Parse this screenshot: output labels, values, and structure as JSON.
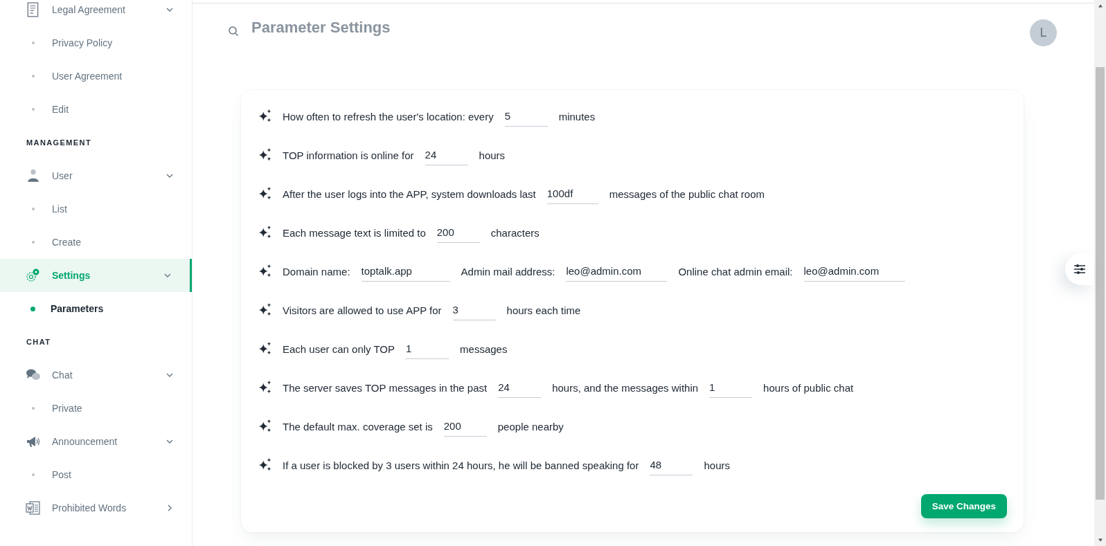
{
  "sidebar": {
    "items": [
      {
        "kind": "group",
        "label": "Legal Agreement",
        "expanded": true,
        "selected": false
      },
      {
        "kind": "sub",
        "label": "Privacy Policy",
        "selected": false
      },
      {
        "kind": "sub",
        "label": "User Agreement",
        "selected": false
      },
      {
        "kind": "sub",
        "label": "Edit",
        "selected": false
      },
      {
        "kind": "section",
        "label": "MANAGEMENT"
      },
      {
        "kind": "group",
        "label": "User",
        "expanded": true,
        "selected": false
      },
      {
        "kind": "sub",
        "label": "List",
        "selected": false
      },
      {
        "kind": "sub",
        "label": "Create",
        "selected": false
      },
      {
        "kind": "group",
        "label": "Settings",
        "expanded": true,
        "selected": true
      },
      {
        "kind": "sub",
        "label": "Parameters",
        "selected": true
      },
      {
        "kind": "section",
        "label": "CHAT"
      },
      {
        "kind": "group",
        "label": "Chat",
        "expanded": true,
        "selected": false
      },
      {
        "kind": "sub",
        "label": "Private",
        "selected": false
      },
      {
        "kind": "group",
        "label": "Announcement",
        "expanded": true,
        "selected": false
      },
      {
        "kind": "sub",
        "label": "Post",
        "selected": false
      },
      {
        "kind": "group",
        "label": "Prohibited Words",
        "expanded": false,
        "selected": false
      }
    ]
  },
  "header": {
    "title": "Parameter Settings",
    "avatar": "L"
  },
  "settings": [
    {
      "parts": [
        {
          "kind": "text",
          "text": "How often to refresh the user's location: every"
        },
        {
          "kind": "field",
          "value": "5"
        },
        {
          "kind": "text",
          "text": "minutes"
        }
      ]
    },
    {
      "parts": [
        {
          "kind": "text",
          "text": "TOP information is online for"
        },
        {
          "kind": "field",
          "value": "24"
        },
        {
          "kind": "text",
          "text": "hours"
        }
      ]
    },
    {
      "parts": [
        {
          "kind": "text",
          "text": "After the user logs into the APP, system downloads last"
        },
        {
          "kind": "field",
          "value": "100df"
        },
        {
          "kind": "text",
          "text": "messages of the public chat room"
        }
      ]
    },
    {
      "parts": [
        {
          "kind": "text",
          "text": "Each message text is limited to"
        },
        {
          "kind": "field",
          "value": "200"
        },
        {
          "kind": "text",
          "text": "characters"
        }
      ]
    },
    {
      "parts": [
        {
          "kind": "text",
          "text": "Domain name:"
        },
        {
          "kind": "field",
          "value": "toptalk.app"
        },
        {
          "kind": "text",
          "text": "Admin mail address:"
        },
        {
          "kind": "field",
          "value": "leo@admin.com"
        },
        {
          "kind": "text",
          "text": "Online chat admin email:"
        },
        {
          "kind": "field",
          "value": "leo@admin.com"
        }
      ]
    },
    {
      "parts": [
        {
          "kind": "text",
          "text": "Visitors are allowed to use APP for"
        },
        {
          "kind": "field",
          "value": "3"
        },
        {
          "kind": "text",
          "text": "hours each time"
        }
      ]
    },
    {
      "parts": [
        {
          "kind": "text",
          "text": "Each user can only TOP"
        },
        {
          "kind": "field",
          "value": "1"
        },
        {
          "kind": "text",
          "text": "messages"
        }
      ]
    },
    {
      "parts": [
        {
          "kind": "text",
          "text": "The server saves TOP messages in the past"
        },
        {
          "kind": "field",
          "value": "24"
        },
        {
          "kind": "text",
          "text": "hours, and the messages within"
        },
        {
          "kind": "field",
          "value": "1"
        },
        {
          "kind": "text",
          "text": "hours of public chat"
        }
      ]
    },
    {
      "parts": [
        {
          "kind": "text",
          "text": "The default max. coverage set is"
        },
        {
          "kind": "field",
          "value": "200"
        },
        {
          "kind": "text",
          "text": "people nearby"
        }
      ]
    },
    {
      "parts": [
        {
          "kind": "text",
          "text": "If a user is blocked by 3 users within 24 hours, he will be banned speaking for"
        },
        {
          "kind": "field",
          "value": "48"
        },
        {
          "kind": "text",
          "text": "hours"
        }
      ]
    }
  ],
  "save_button": "Save Changes"
}
